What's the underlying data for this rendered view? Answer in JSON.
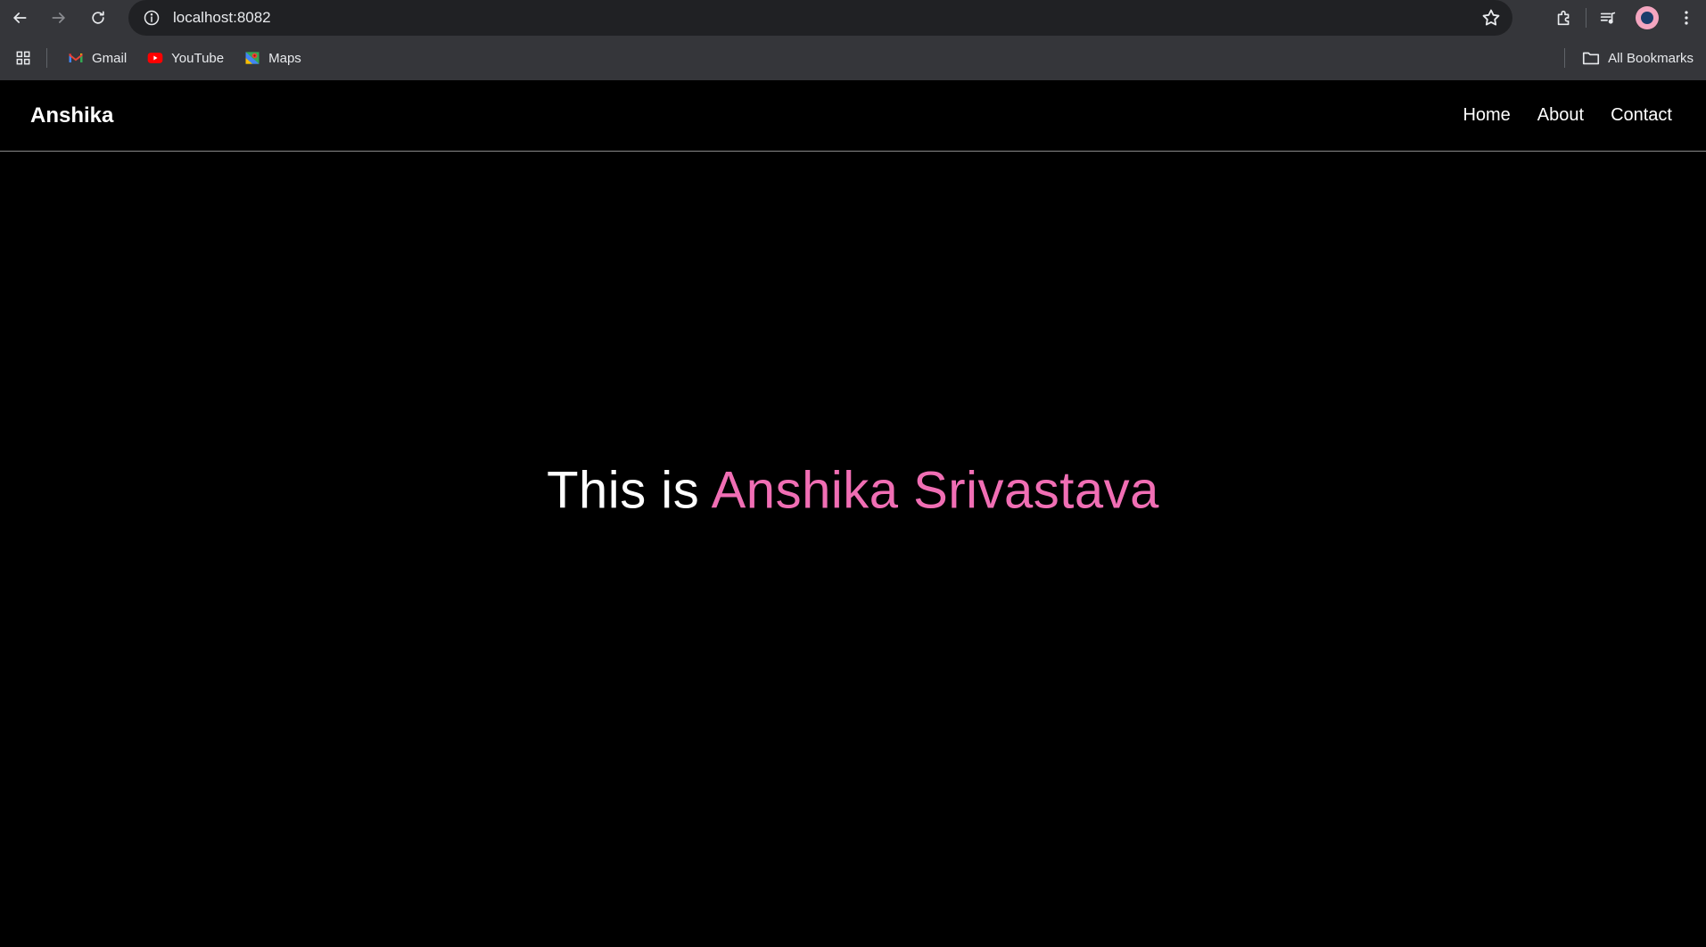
{
  "browser": {
    "url": "localhost:8082",
    "bookmarks": [
      {
        "label": "Gmail",
        "icon": "gmail-icon"
      },
      {
        "label": "YouTube",
        "icon": "youtube-icon"
      },
      {
        "label": "Maps",
        "icon": "maps-icon"
      }
    ],
    "all_bookmarks_label": "All Bookmarks"
  },
  "site": {
    "brand": "Anshika",
    "nav": [
      {
        "label": "Home"
      },
      {
        "label": "About"
      },
      {
        "label": "Contact"
      }
    ],
    "hero": {
      "prefix": "This is ",
      "name": "Anshika Srivastava"
    }
  },
  "colors": {
    "background": "#000000",
    "accent": "#f06eb4",
    "chrome": "#35363a",
    "omnibox": "#202124"
  }
}
